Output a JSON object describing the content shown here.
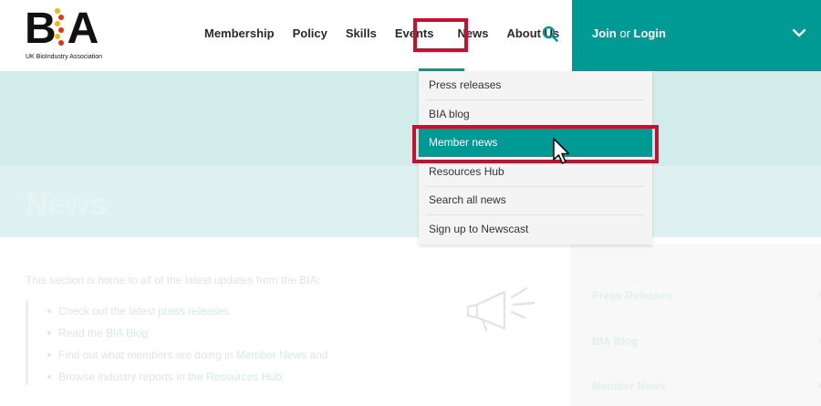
{
  "logo": {
    "mark_left": "B",
    "mark_right": "A",
    "subtitle": "UK BioIndustry Association"
  },
  "nav": {
    "items": [
      {
        "label": "Membership"
      },
      {
        "label": "Policy"
      },
      {
        "label": "Skills"
      },
      {
        "label": "Events"
      },
      {
        "label": "News"
      },
      {
        "label": "About Us"
      }
    ],
    "search_icon": "search-icon"
  },
  "login": {
    "join": "Join",
    "or": "or",
    "login": "Login",
    "icon": "chevron-down-icon"
  },
  "hero": {
    "title": "News"
  },
  "dropdown": {
    "items": [
      {
        "label": "Press releases"
      },
      {
        "label": "BIA blog"
      },
      {
        "label": "Member news"
      },
      {
        "label": "Resources Hub"
      },
      {
        "label": "Search all news"
      },
      {
        "label": "Sign up to Newscast"
      }
    ],
    "active": "Member news"
  },
  "content": {
    "intro": "This section is home to all of the latest updates from the BIA:",
    "bullets": [
      {
        "text": "Check out the latest ",
        "link": "press releases",
        "after": ""
      },
      {
        "text": "Read the ",
        "link": "BIA Blog",
        "after": ""
      },
      {
        "text": "Find out what members are doing in ",
        "link": "Member News",
        "after": " and"
      },
      {
        "text": "Browse industry reports in ",
        "link": "the Resources Hub",
        "after": "."
      }
    ],
    "icon": "megaphone-icon"
  },
  "side_panel": {
    "items": [
      {
        "label": "Press Releases"
      },
      {
        "label": "BIA Blog"
      },
      {
        "label": "Member News"
      }
    ]
  },
  "colors": {
    "teal": "#009a95",
    "highlight_red": "#c8102e"
  }
}
